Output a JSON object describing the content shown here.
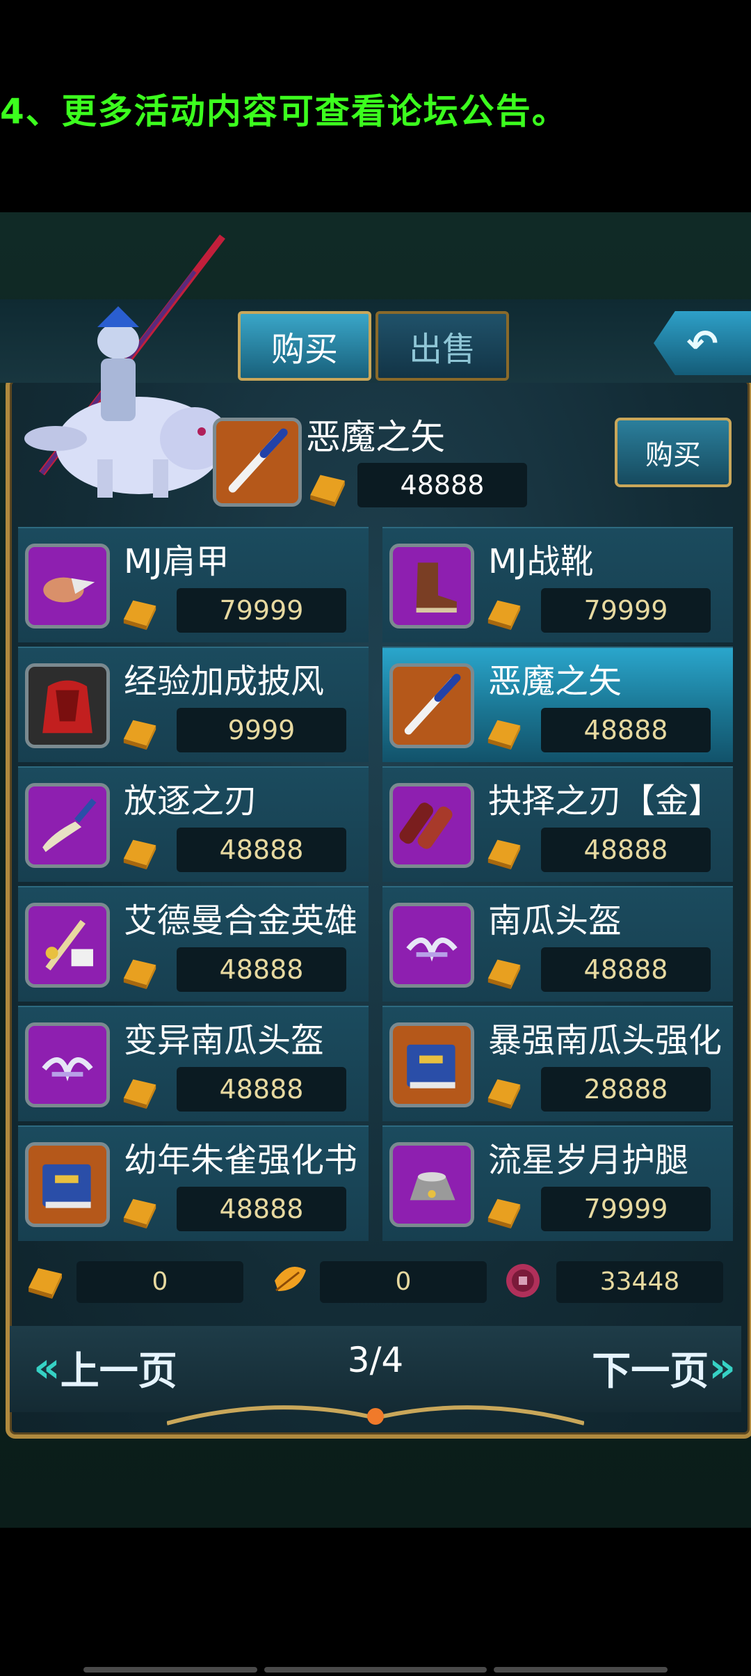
{
  "notice_text": "4、更多活动内容可查看论坛公告。",
  "tabs": {
    "buy": "购买",
    "sell": "出售"
  },
  "back_icon": "return-arrow-icon",
  "featured": {
    "name": "恶魔之矢",
    "price": "48888",
    "buy_label": "购买",
    "icon": "dagger-icon"
  },
  "items": [
    {
      "name": "MJ肩甲",
      "price": "79999",
      "icon": "shoulder-armor-icon",
      "bg": "#8e1fb0"
    },
    {
      "name": "MJ战靴",
      "price": "79999",
      "icon": "boots-icon",
      "bg": "#8e1fb0"
    },
    {
      "name": "经验加成披风",
      "price": "9999",
      "icon": "cape-icon",
      "bg": "#2d2d2d"
    },
    {
      "name": "恶魔之矢",
      "price": "48888",
      "icon": "dagger-icon",
      "bg": "#b5581a"
    },
    {
      "name": "放逐之刃",
      "price": "48888",
      "icon": "scimitar-icon",
      "bg": "#8e1fb0"
    },
    {
      "name": "抉择之刃【金】",
      "price": "48888",
      "icon": "blade-icon",
      "bg": "#8e1fb0"
    },
    {
      "name": "艾德曼合金英雄",
      "price": "48888",
      "icon": "hammer-icon",
      "bg": "#8e1fb0"
    },
    {
      "name": "南瓜头盔",
      "price": "48888",
      "icon": "helmet-wings-icon",
      "bg": "#8e1fb0"
    },
    {
      "name": "变异南瓜头盔",
      "price": "48888",
      "icon": "helmet-wings-icon",
      "bg": "#8e1fb0"
    },
    {
      "name": "暴强南瓜头强化",
      "price": "28888",
      "icon": "book-icon",
      "bg": "#b5581a"
    },
    {
      "name": "幼年朱雀强化书",
      "price": "48888",
      "icon": "book-icon",
      "bg": "#b5581a"
    },
    {
      "name": "流星岁月护腿",
      "price": "79999",
      "icon": "leg-guard-icon",
      "bg": "#8e1fb0"
    }
  ],
  "currency": {
    "gold": "0",
    "leaf": "0",
    "coin": "33448"
  },
  "nav": {
    "prev_label": "上一页",
    "next_label": "下一页",
    "page": "3/4"
  },
  "colors": {
    "notice": "#3cff1e",
    "selected_card": "#2aa6cc",
    "frame_gold": "#b08a3e"
  }
}
